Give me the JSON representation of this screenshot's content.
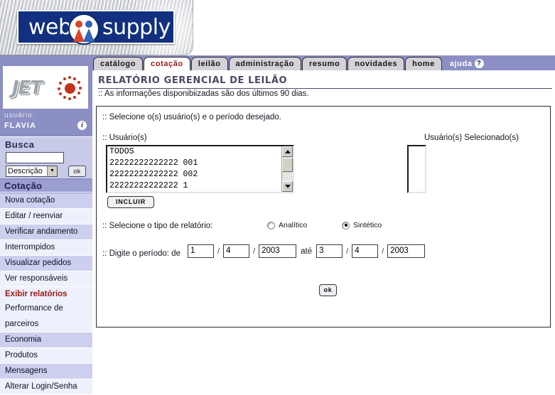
{
  "banner": {
    "logo_web": "web",
    "logo_supply": "supply",
    "emblem_icon": "two-people-emblem-icon"
  },
  "tabs": [
    {
      "label": "catálogo",
      "active": false
    },
    {
      "label": "cotação",
      "active": true
    },
    {
      "label": "leilão",
      "active": false
    },
    {
      "label": "administração",
      "active": false
    },
    {
      "label": "resumo",
      "active": false
    },
    {
      "label": "novidades",
      "active": false
    },
    {
      "label": "home",
      "active": false
    }
  ],
  "help_tab": {
    "label": "ajuda",
    "icon": "question-mark-icon",
    "glyph": "?"
  },
  "sidebar": {
    "brand": "JET",
    "brand_icon": "jet-sun-icon",
    "user_label": "usuário:",
    "user_name": "FLAVIA",
    "user_info_icon": "info-icon",
    "user_info_glyph": "i",
    "search": {
      "title": "Busca",
      "input_value": "",
      "input_placeholder": "",
      "select_value": "Descrição",
      "select_arrow_icon": "chevron-down-icon",
      "select_arrow_glyph": "▼",
      "ok_label": "ok"
    },
    "section_title": "Cotação",
    "items": [
      {
        "label": "Nova cotação",
        "highlighted": false
      },
      {
        "label": "Editar / reenviar",
        "highlighted": false
      },
      {
        "label": "Verificar andamento",
        "highlighted": false
      },
      {
        "label": "Interrompidos",
        "highlighted": false
      },
      {
        "label": "Visualizar pedidos",
        "highlighted": false
      },
      {
        "label": "Ver responsáveis",
        "highlighted": false
      },
      {
        "label": "Exibir relatórios",
        "highlighted": true
      },
      {
        "label": "Performance de",
        "highlighted": false
      },
      {
        "label": "parceiros",
        "highlighted": false
      },
      {
        "label": "Economia",
        "highlighted": false
      },
      {
        "label": "Produtos",
        "highlighted": false
      },
      {
        "label": "Mensagens",
        "highlighted": false
      },
      {
        "label": "Alterar Login/Senha",
        "highlighted": false
      }
    ]
  },
  "main": {
    "title": "RELATÓRIO GERENCIAL DE LEILÃO",
    "subtitle": ":: As informações disponibiizadas são dos últimos 90 dias.",
    "panel_instruction": ":: Selecione o(s) usuário(s) e o período desejado.",
    "users_label": ":: Usuário(s)",
    "users_listbox": [
      "TODOS",
      "22222222222222 001",
      "22222222222222 002",
      "22222222222222 1"
    ],
    "include_button": "INCLUIR",
    "selected_users_label": "Usuário(s) Selecionado(s)",
    "selected_users_items": [],
    "report_type_label": ":: Selecione o tipo de relatório:",
    "report_types": [
      {
        "label": "Analítico",
        "checked": false
      },
      {
        "label": "Sintético",
        "checked": true
      }
    ],
    "period_label": ":: Digite o período: de",
    "period_until": "até",
    "period_separator": "/",
    "period_from": {
      "day": "1",
      "month": "4",
      "year": "2003"
    },
    "period_to": {
      "day": "3",
      "month": "4",
      "year": "2003"
    },
    "ok_button": "ok"
  },
  "colors": {
    "brand_blue": "#12307f",
    "nav_purple": "#8b8fc4",
    "sidebar_item": "#ccd0ee",
    "sidebar_item_alt": "#eef0fb",
    "active_tab_text": "#9b1c1c",
    "highlight_red": "#9b1616",
    "title_gray": "#494966"
  }
}
